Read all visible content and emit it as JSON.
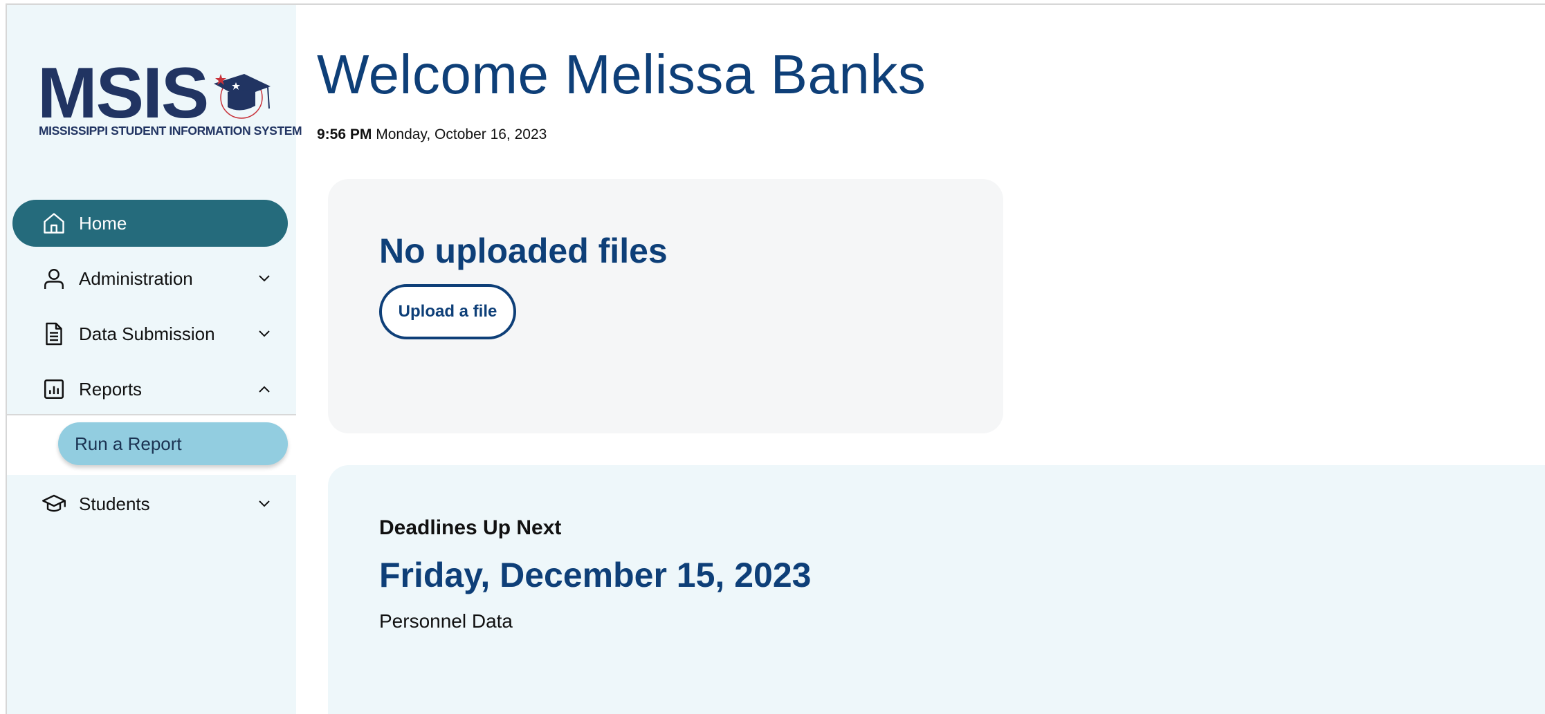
{
  "logo": {
    "acronym": "MSIS",
    "subtitle": "MISSISSIPPI STUDENT INFORMATION SYSTEM"
  },
  "sidebar": {
    "items": [
      {
        "label": "Home",
        "icon": "home-icon",
        "active": true
      },
      {
        "label": "Administration",
        "icon": "user-icon",
        "expanded": false
      },
      {
        "label": "Data Submission",
        "icon": "document-icon",
        "expanded": false
      },
      {
        "label": "Reports",
        "icon": "bar-chart-icon",
        "expanded": true
      },
      {
        "label": "Students",
        "icon": "graduation-cap-icon",
        "expanded": false
      }
    ],
    "reports_sub": {
      "label": "Run a Report"
    }
  },
  "header": {
    "title": "Welcome Melissa Banks",
    "time": "9:56 PM",
    "date": "Monday, October 16, 2023"
  },
  "uploads": {
    "heading": "No uploaded files",
    "button_label": "Upload a file"
  },
  "deadlines": {
    "heading": "Deadlines Up Next",
    "date": "Friday, December 15, 2023",
    "item": "Personnel Data"
  },
  "colors": {
    "primary": "#0e3f78",
    "active_nav": "#256b7c",
    "sub_button": "#92cde0",
    "sidebar_bg": "#eef7fa",
    "logo": "#213462"
  }
}
